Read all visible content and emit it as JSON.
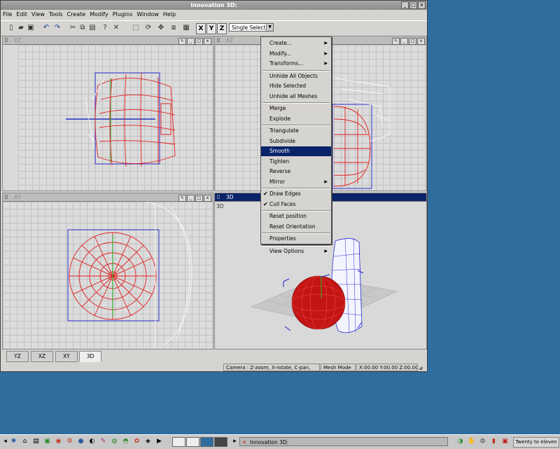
{
  "window": {
    "title": "Innovation 3D:"
  },
  "menubar": [
    "File",
    "Edit",
    "View",
    "Tools",
    "Create",
    "Modify",
    "Plugins",
    "Window",
    "Help"
  ],
  "toolbar": {
    "axis_buttons": [
      "X",
      "Y",
      "Z"
    ],
    "select_mode": "Single Select"
  },
  "viewports": {
    "top_left": "YZ",
    "top_right": "XZ",
    "bottom_left": "XY",
    "bottom_right": "3D",
    "bottom_right_label": "3D"
  },
  "context_menu": {
    "items": [
      {
        "label": "Create...",
        "submenu": true
      },
      {
        "label": "Modify...",
        "submenu": true
      },
      {
        "label": "Transforms...",
        "submenu": true
      },
      {
        "label": "Unhide All Objects"
      },
      {
        "label": "Hide Selected"
      },
      {
        "label": "Unhide all Meshes"
      },
      {
        "label": "Merge"
      },
      {
        "label": "Explode"
      },
      {
        "label": "Triangulate"
      },
      {
        "label": "Subdivide"
      },
      {
        "label": "Smooth",
        "highlighted": true
      },
      {
        "label": "Tighten"
      },
      {
        "label": "Reverse"
      },
      {
        "label": "Mirror",
        "submenu": true
      },
      {
        "label": "Draw Edges",
        "checked": true
      },
      {
        "label": "Cull Faces",
        "checked": true
      },
      {
        "label": "Reset position"
      },
      {
        "label": "Reset Orientation"
      },
      {
        "label": "Properties"
      },
      {
        "label": "View Options",
        "submenu": true
      }
    ]
  },
  "view_tabs": [
    "YZ",
    "XZ",
    "XY",
    "3D"
  ],
  "active_tab": "3D",
  "status": {
    "camera": "Camera : Z-zoom, X-rotate, C-pan,",
    "mode": "Mesh Mode",
    "coords": "X:00.00 Y:00.00 Z:00.00"
  },
  "taskbar": {
    "app": "Innovation 3D:",
    "clock": "Twenty to eleven"
  },
  "colors": {
    "desktop": "#2f6d9f",
    "selection": "#0a246a",
    "mesh": "#e02020",
    "bounds": "#3030d0"
  }
}
